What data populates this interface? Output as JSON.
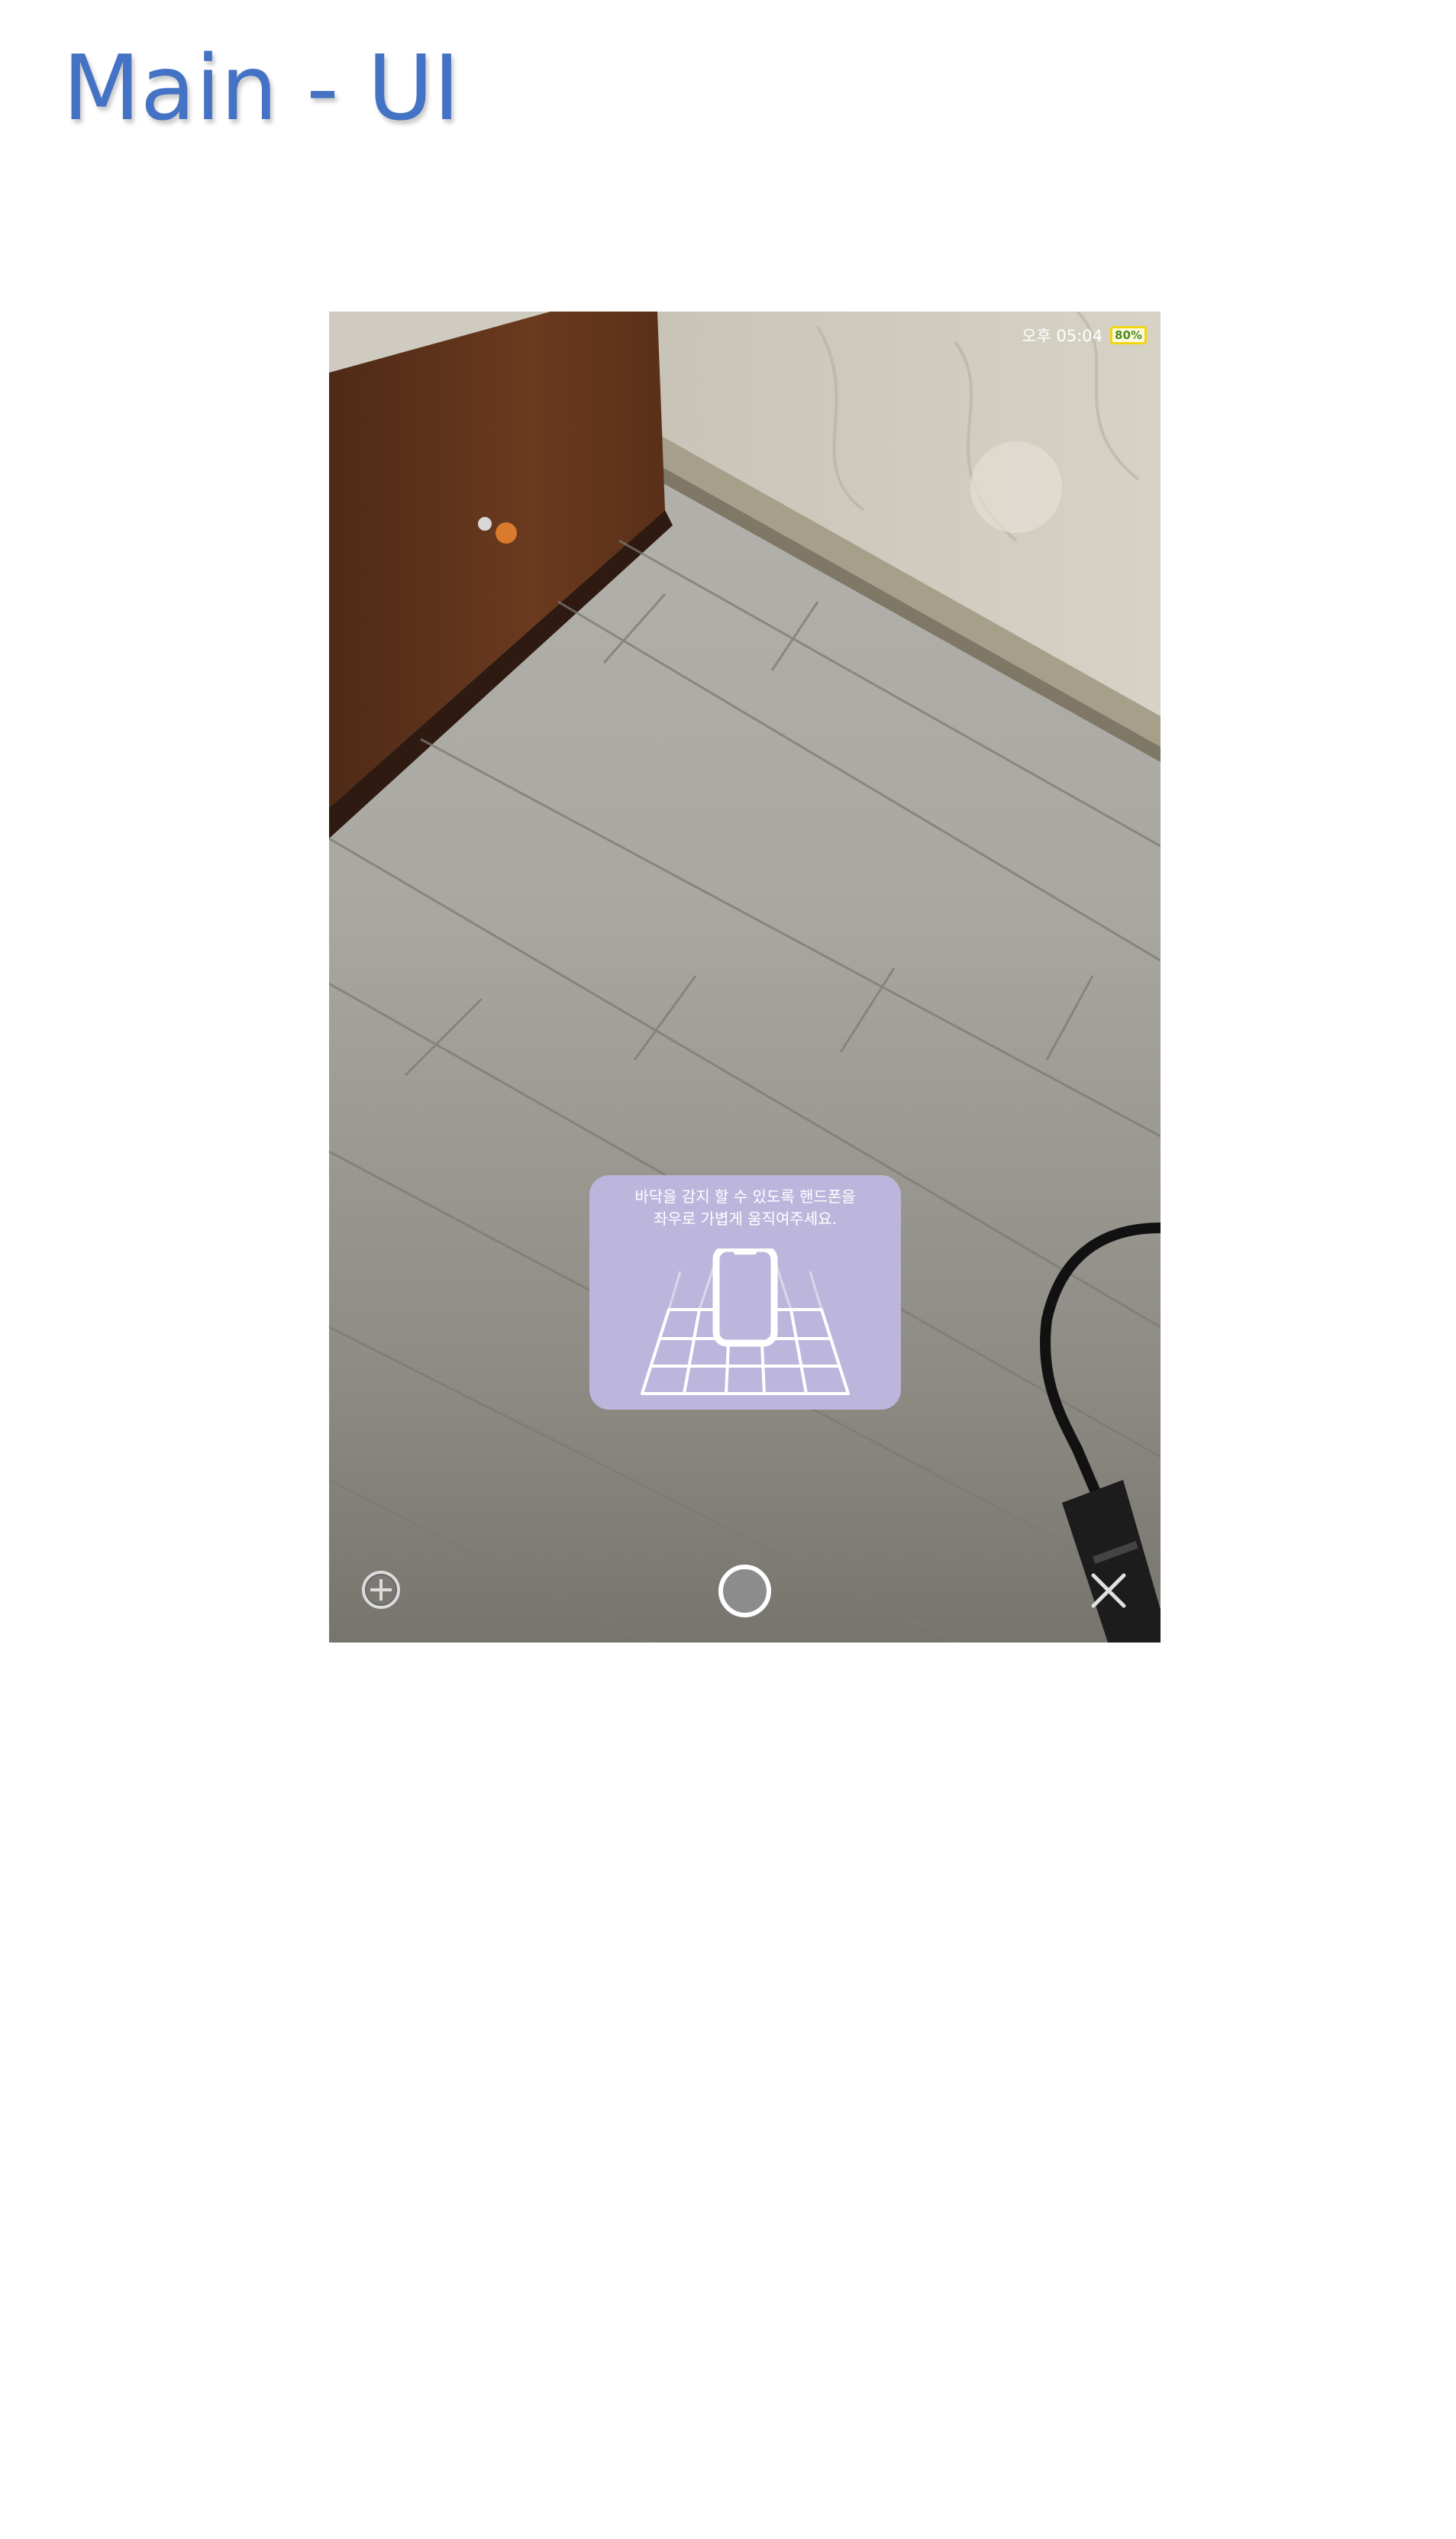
{
  "slide": {
    "title": "Main - UI"
  },
  "status_bar": {
    "time": "오후 05:04",
    "battery_percent": "80%",
    "battery_color": "#f2d60a"
  },
  "guide_card": {
    "message_line1": "바닥을 감지 할 수 있도록 핸드폰을",
    "message_line2": "좌우로 가볍게 움직여주세요.",
    "background_color": "#bdb6dc",
    "illustration_icon": "phone-over-floor-grid-icon"
  },
  "controls": {
    "add_icon": "plus-circle-icon",
    "shutter_icon": "shutter-circle-icon",
    "close_icon": "close-x-icon"
  },
  "colors": {
    "title": "#4472c4"
  }
}
